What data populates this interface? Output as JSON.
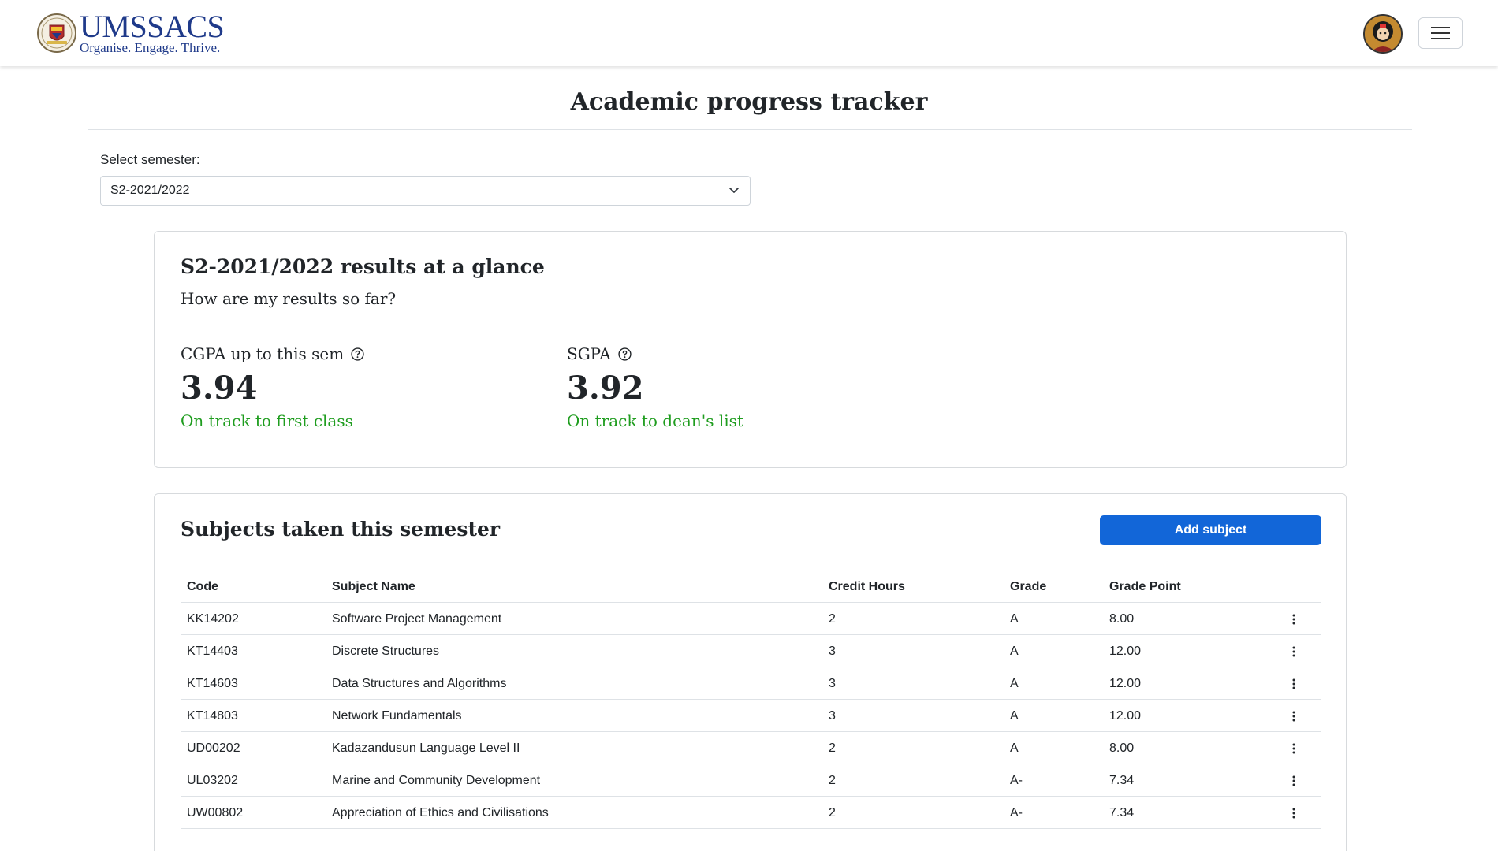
{
  "navbar": {
    "brand_name": "UMSSACS",
    "brand_tagline": "Organise. Engage. Thrive."
  },
  "page": {
    "title": "Academic progress tracker"
  },
  "semester_select": {
    "label": "Select semester:",
    "value": "S2-2021/2022"
  },
  "glance": {
    "title": "S2-2021/2022 results at a glance",
    "subtitle": "How are my results so far?",
    "cgpa": {
      "label": "CGPA up to this sem",
      "value": "3.94",
      "status": "On track to first class"
    },
    "sgpa": {
      "label": "SGPA",
      "value": "3.92",
      "status": "On track to dean's list"
    },
    "status_color": "#1f9d1f"
  },
  "subjects": {
    "title": "Subjects taken this semester",
    "add_button": "Add subject",
    "columns": [
      "Code",
      "Subject Name",
      "Credit Hours",
      "Grade",
      "Grade Point"
    ],
    "rows": [
      {
        "code": "KK14202",
        "name": "Software Project Management",
        "credit": "2",
        "grade": "A",
        "point": "8.00"
      },
      {
        "code": "KT14403",
        "name": "Discrete Structures",
        "credit": "3",
        "grade": "A",
        "point": "12.00"
      },
      {
        "code": "KT14603",
        "name": "Data Structures and Algorithms",
        "credit": "3",
        "grade": "A",
        "point": "12.00"
      },
      {
        "code": "KT14803",
        "name": "Network Fundamentals",
        "credit": "3",
        "grade": "A",
        "point": "12.00"
      },
      {
        "code": "UD00202",
        "name": "Kadazandusun Language Level II",
        "credit": "2",
        "grade": "A",
        "point": "8.00"
      },
      {
        "code": "UL03202",
        "name": "Marine and Community Development",
        "credit": "2",
        "grade": "A-",
        "point": "7.34"
      },
      {
        "code": "UW00802",
        "name": "Appreciation of Ethics and Civilisations",
        "credit": "2",
        "grade": "A-",
        "point": "7.34"
      }
    ]
  },
  "colors": {
    "brand": "#1f3a8a",
    "primary_button": "#1266d8",
    "success_text": "#1f9d1f"
  },
  "icons": {
    "logo": "university-crest-icon",
    "avatar": "profile-avatar",
    "menu": "hamburger-menu-icon",
    "help": "question-circle-icon",
    "dropdown": "chevron-down-icon",
    "row_menu": "vertical-ellipsis-icon"
  }
}
